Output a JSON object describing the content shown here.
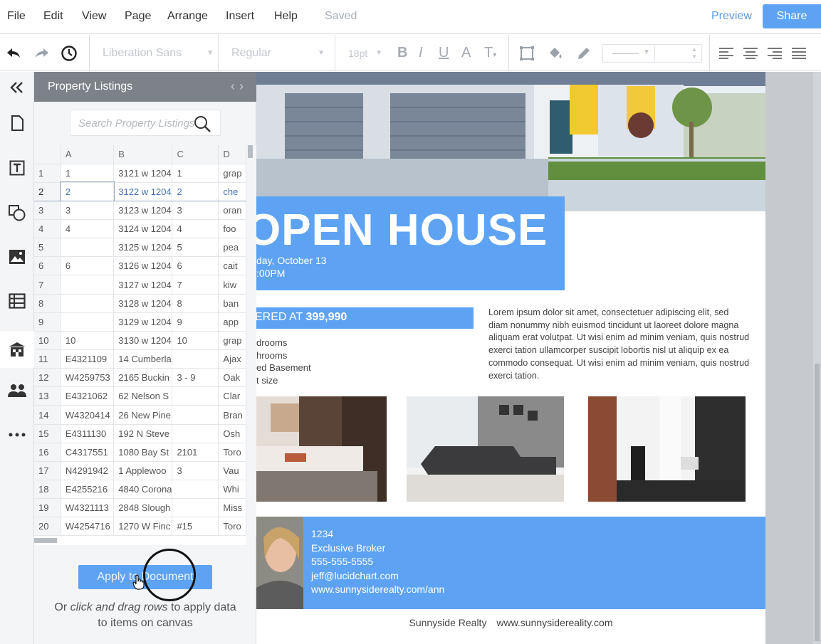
{
  "menu": {
    "items": [
      "File",
      "Edit",
      "View",
      "Page",
      "Arrange",
      "Insert",
      "Help"
    ],
    "status": "Saved",
    "preview_label": "Preview",
    "share_label": "Share"
  },
  "toolbar": {
    "font_family": "Liberation Sans",
    "font_weight": "Regular",
    "font_size": "18pt",
    "bold": "B",
    "italic": "I",
    "underline": "U",
    "text_color": "A",
    "text_options": "T",
    "icons": [
      "undo-icon",
      "redo-icon",
      "history-icon",
      "shape-border-icon",
      "fill-bucket-icon",
      "pencil-icon",
      "align-left-icon",
      "align-center-icon",
      "align-right-icon",
      "align-justify-icon"
    ]
  },
  "rail": {
    "icons": [
      "collapse-icon",
      "page-icon",
      "text-icon",
      "shapes-icon",
      "image-icon",
      "table-icon",
      "building-icon",
      "people-icon",
      "more-icon"
    ]
  },
  "panel": {
    "title": "Property Listings",
    "search_placeholder": "Search Property Listings",
    "columns": [
      "A",
      "B",
      "C",
      "D"
    ],
    "rows": [
      {
        "n": "1",
        "a": "1",
        "b": "3121 w 1204",
        "c": "1",
        "d": "grap"
      },
      {
        "n": "2",
        "a": "2",
        "b": "3122 w 1204",
        "c": "2",
        "d": "che"
      },
      {
        "n": "3",
        "a": "3",
        "b": "3123 w 1204",
        "c": "3",
        "d": "oran"
      },
      {
        "n": "4",
        "a": "4",
        "b": "3124 w 1204",
        "c": "4",
        "d": "foo"
      },
      {
        "n": "5",
        "a": "",
        "b": "3125 w 1204",
        "c": "5",
        "d": "pea"
      },
      {
        "n": "6",
        "a": "6",
        "b": "3126 w 1204",
        "c": "6",
        "d": "cait"
      },
      {
        "n": "7",
        "a": "",
        "b": "3127 w 1204",
        "c": "7",
        "d": "kiw"
      },
      {
        "n": "8",
        "a": "",
        "b": "3128 w 1204",
        "c": "8",
        "d": "ban"
      },
      {
        "n": "9",
        "a": "",
        "b": "3129 w 1204",
        "c": "9",
        "d": "app"
      },
      {
        "n": "10",
        "a": "10",
        "b": "3130 w 1204",
        "c": "10",
        "d": "grap"
      },
      {
        "n": "11",
        "a": "E4321109",
        "b": "14 Cumberla",
        "c": "",
        "d": "Ajax"
      },
      {
        "n": "12",
        "a": "W4259753",
        "b": "2165 Buckin",
        "c": "3 - 9",
        "d": "Oak"
      },
      {
        "n": "13",
        "a": "E4321062",
        "b": "62 Nelson S",
        "c": "",
        "d": "Clar"
      },
      {
        "n": "14",
        "a": "W4320414",
        "b": "26 New Pine",
        "c": "",
        "d": "Bran"
      },
      {
        "n": "15",
        "a": "E4311130",
        "b": "192 N Steve",
        "c": "",
        "d": "Osh"
      },
      {
        "n": "16",
        "a": "C4317551",
        "b": "1080 Bay St",
        "c": "2101",
        "d": "Toro"
      },
      {
        "n": "17",
        "a": "N4291942",
        "b": "1 Applewoo",
        "c": "3",
        "d": "Vau"
      },
      {
        "n": "18",
        "a": "E4255216",
        "b": "4840 Corona",
        "c": "",
        "d": "Whi"
      },
      {
        "n": "19",
        "a": "W4321113",
        "b": "2848 Slough",
        "c": "",
        "d": "Miss"
      },
      {
        "n": "20",
        "a": "W4254716",
        "b": "1270 W Finc",
        "c": "#15",
        "d": "Toro"
      }
    ],
    "apply_label": "Apply to Document",
    "hint_prefix": "Or ",
    "hint_em": "click and drag rows",
    "hint_suffix": " to apply data to items on canvas"
  },
  "flyer": {
    "headline": "OPEN HOUSE",
    "date": "day, October 13",
    "time": ":00PM",
    "price_prefix": "ERED AT ",
    "price": "399,990",
    "features": [
      "drooms",
      "hrooms",
      "ed Basement",
      "t size"
    ],
    "lorem": "Lorem ipsum dolor sit amet, consectetuer adipiscing elit, sed diam nonummy nibh euismod tincidunt ut laoreet dolore magna aliquam erat volutpat. Ut wisi enim ad minim veniam, quis nostrud exerci tation ullamcorper suscipit lobortis nisl ut aliquip ex ea commodo consequat. Ut wisi enim ad minim veniam, quis nostrud exerci tation.",
    "agent": {
      "line1": "1234",
      "title": "Exclusive Broker",
      "phone": "555-555-5555",
      "email": "jeff@lucidchart.com",
      "web": "www.sunnysiderealty.com/ann"
    },
    "footer_company": "Sunnyside Realty",
    "footer_url": "www.sunnysidereality.com"
  },
  "colors": {
    "accent": "#5ea3f3",
    "panel_header": "#7d8288",
    "canvas_bg": "#c6c9ce"
  }
}
